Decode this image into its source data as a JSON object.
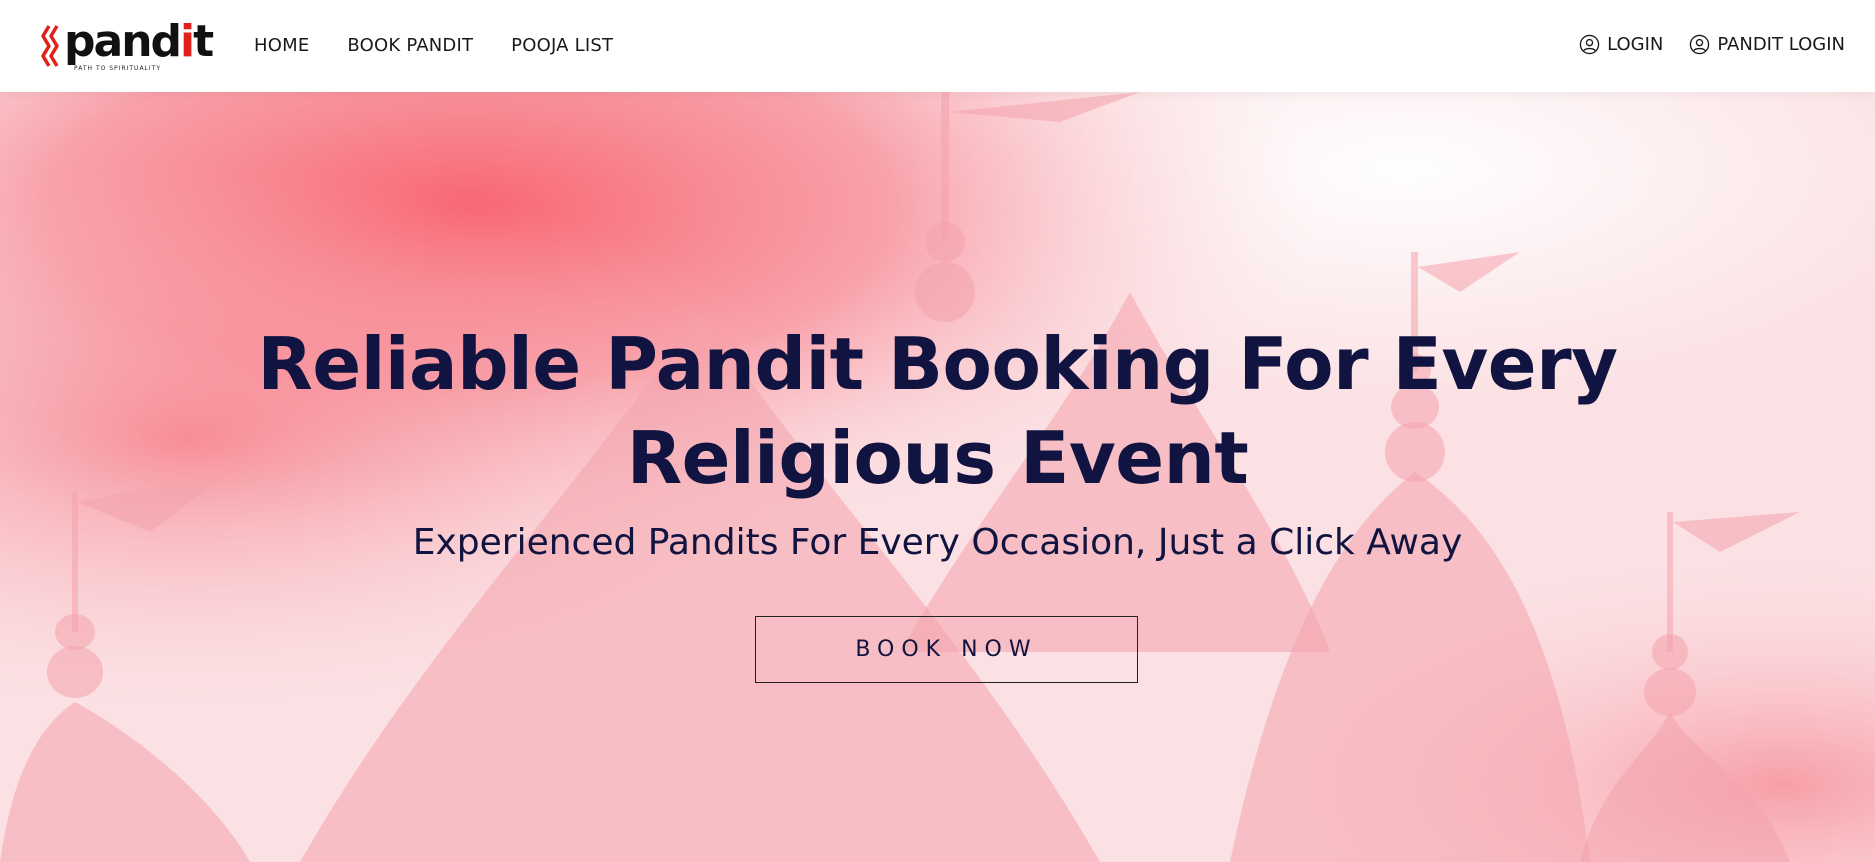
{
  "brand": {
    "logo_text_prefix": "pand",
    "logo_text_red": "i",
    "logo_text_suffix": "t",
    "tagline": "PATH TO SPIRITUALITY",
    "accent_color": "#e0211b"
  },
  "nav": {
    "items": [
      {
        "label": "HOME"
      },
      {
        "label": "BOOK PANDIT"
      },
      {
        "label": "POOJA LIST"
      }
    ]
  },
  "auth": {
    "login_label": "LOGIN",
    "pandit_login_label": "PANDIT LOGIN",
    "icon": "user-circle-icon"
  },
  "hero": {
    "title_line1": "Reliable Pandit Booking For Every",
    "title_line2": "Religious Event",
    "subtitle": "Experienced Pandits For Every Occasion, Just a Click Away",
    "cta_label": "BOOK NOW",
    "text_color": "#111440",
    "background": "temple-silhouette-watercolor"
  }
}
